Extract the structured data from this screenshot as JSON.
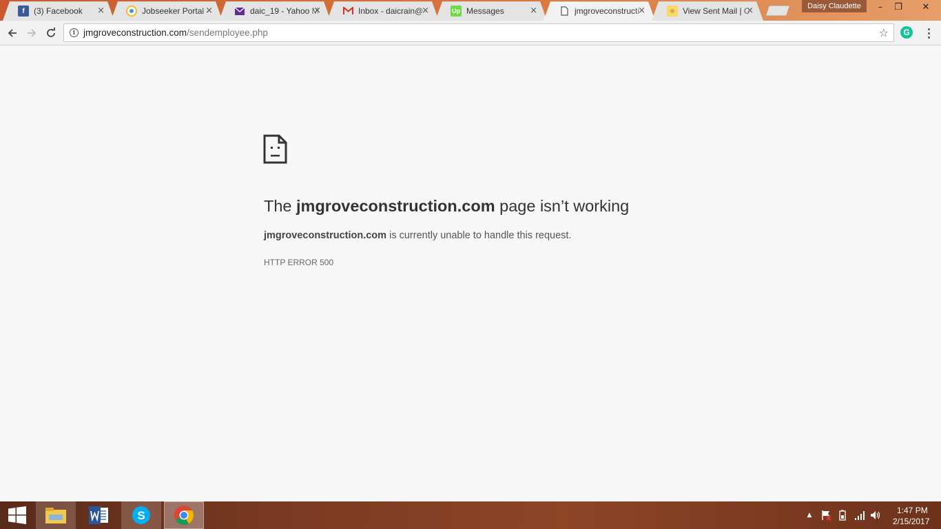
{
  "browser": {
    "tabs": [
      {
        "title": "(3) Facebook",
        "icon": "facebook-icon",
        "icon_color": "#3b5998",
        "icon_glyph": "f",
        "close": "×"
      },
      {
        "title": "Jobseeker Portal -",
        "icon": "portal-icon",
        "icon_color": "#f0c020",
        "icon_glyph": "",
        "close": "×"
      },
      {
        "title": "daic_19 - Yahoo M",
        "icon": "yahoo-mail-icon",
        "icon_color": "#5f2c91",
        "icon_glyph": "",
        "close": "×"
      },
      {
        "title": "Inbox - daicrain@",
        "icon": "gmail-icon",
        "icon_color": "#d93025",
        "icon_glyph": "M",
        "close": "×"
      },
      {
        "title": "Messages",
        "icon": "upwork-icon",
        "icon_color": "#6fda44",
        "icon_glyph": "Up",
        "close": "×"
      },
      {
        "title": "jmgroveconstructi",
        "icon": "page-icon",
        "icon_color": "#ffffff",
        "icon_glyph": "",
        "close": "×"
      },
      {
        "title": "View Sent Mail | C",
        "icon": "sent-mail-icon",
        "icon_color": "#f5d76e",
        "icon_glyph": "",
        "close": "×"
      }
    ],
    "active_tab_index": 5,
    "profile_name": "Daisy Claudette",
    "window_controls": {
      "minimize": "–",
      "restore": "❐",
      "close": "✕"
    },
    "url": {
      "host": "jmgroveconstruction.com",
      "path": "/sendemployee.php"
    }
  },
  "error_page": {
    "heading_prefix": "The ",
    "heading_host": "jmgroveconstruction.com",
    "heading_suffix": " page isn’t working",
    "desc_host": "jmgroveconstruction.com",
    "desc_suffix": " is currently unable to handle this request.",
    "error_code": "HTTP ERROR 500"
  },
  "taskbar": {
    "apps": [
      "file-explorer",
      "microsoft-word",
      "skype",
      "google-chrome"
    ],
    "clock_time": "1:47 PM",
    "clock_date": "2/15/2017"
  }
}
